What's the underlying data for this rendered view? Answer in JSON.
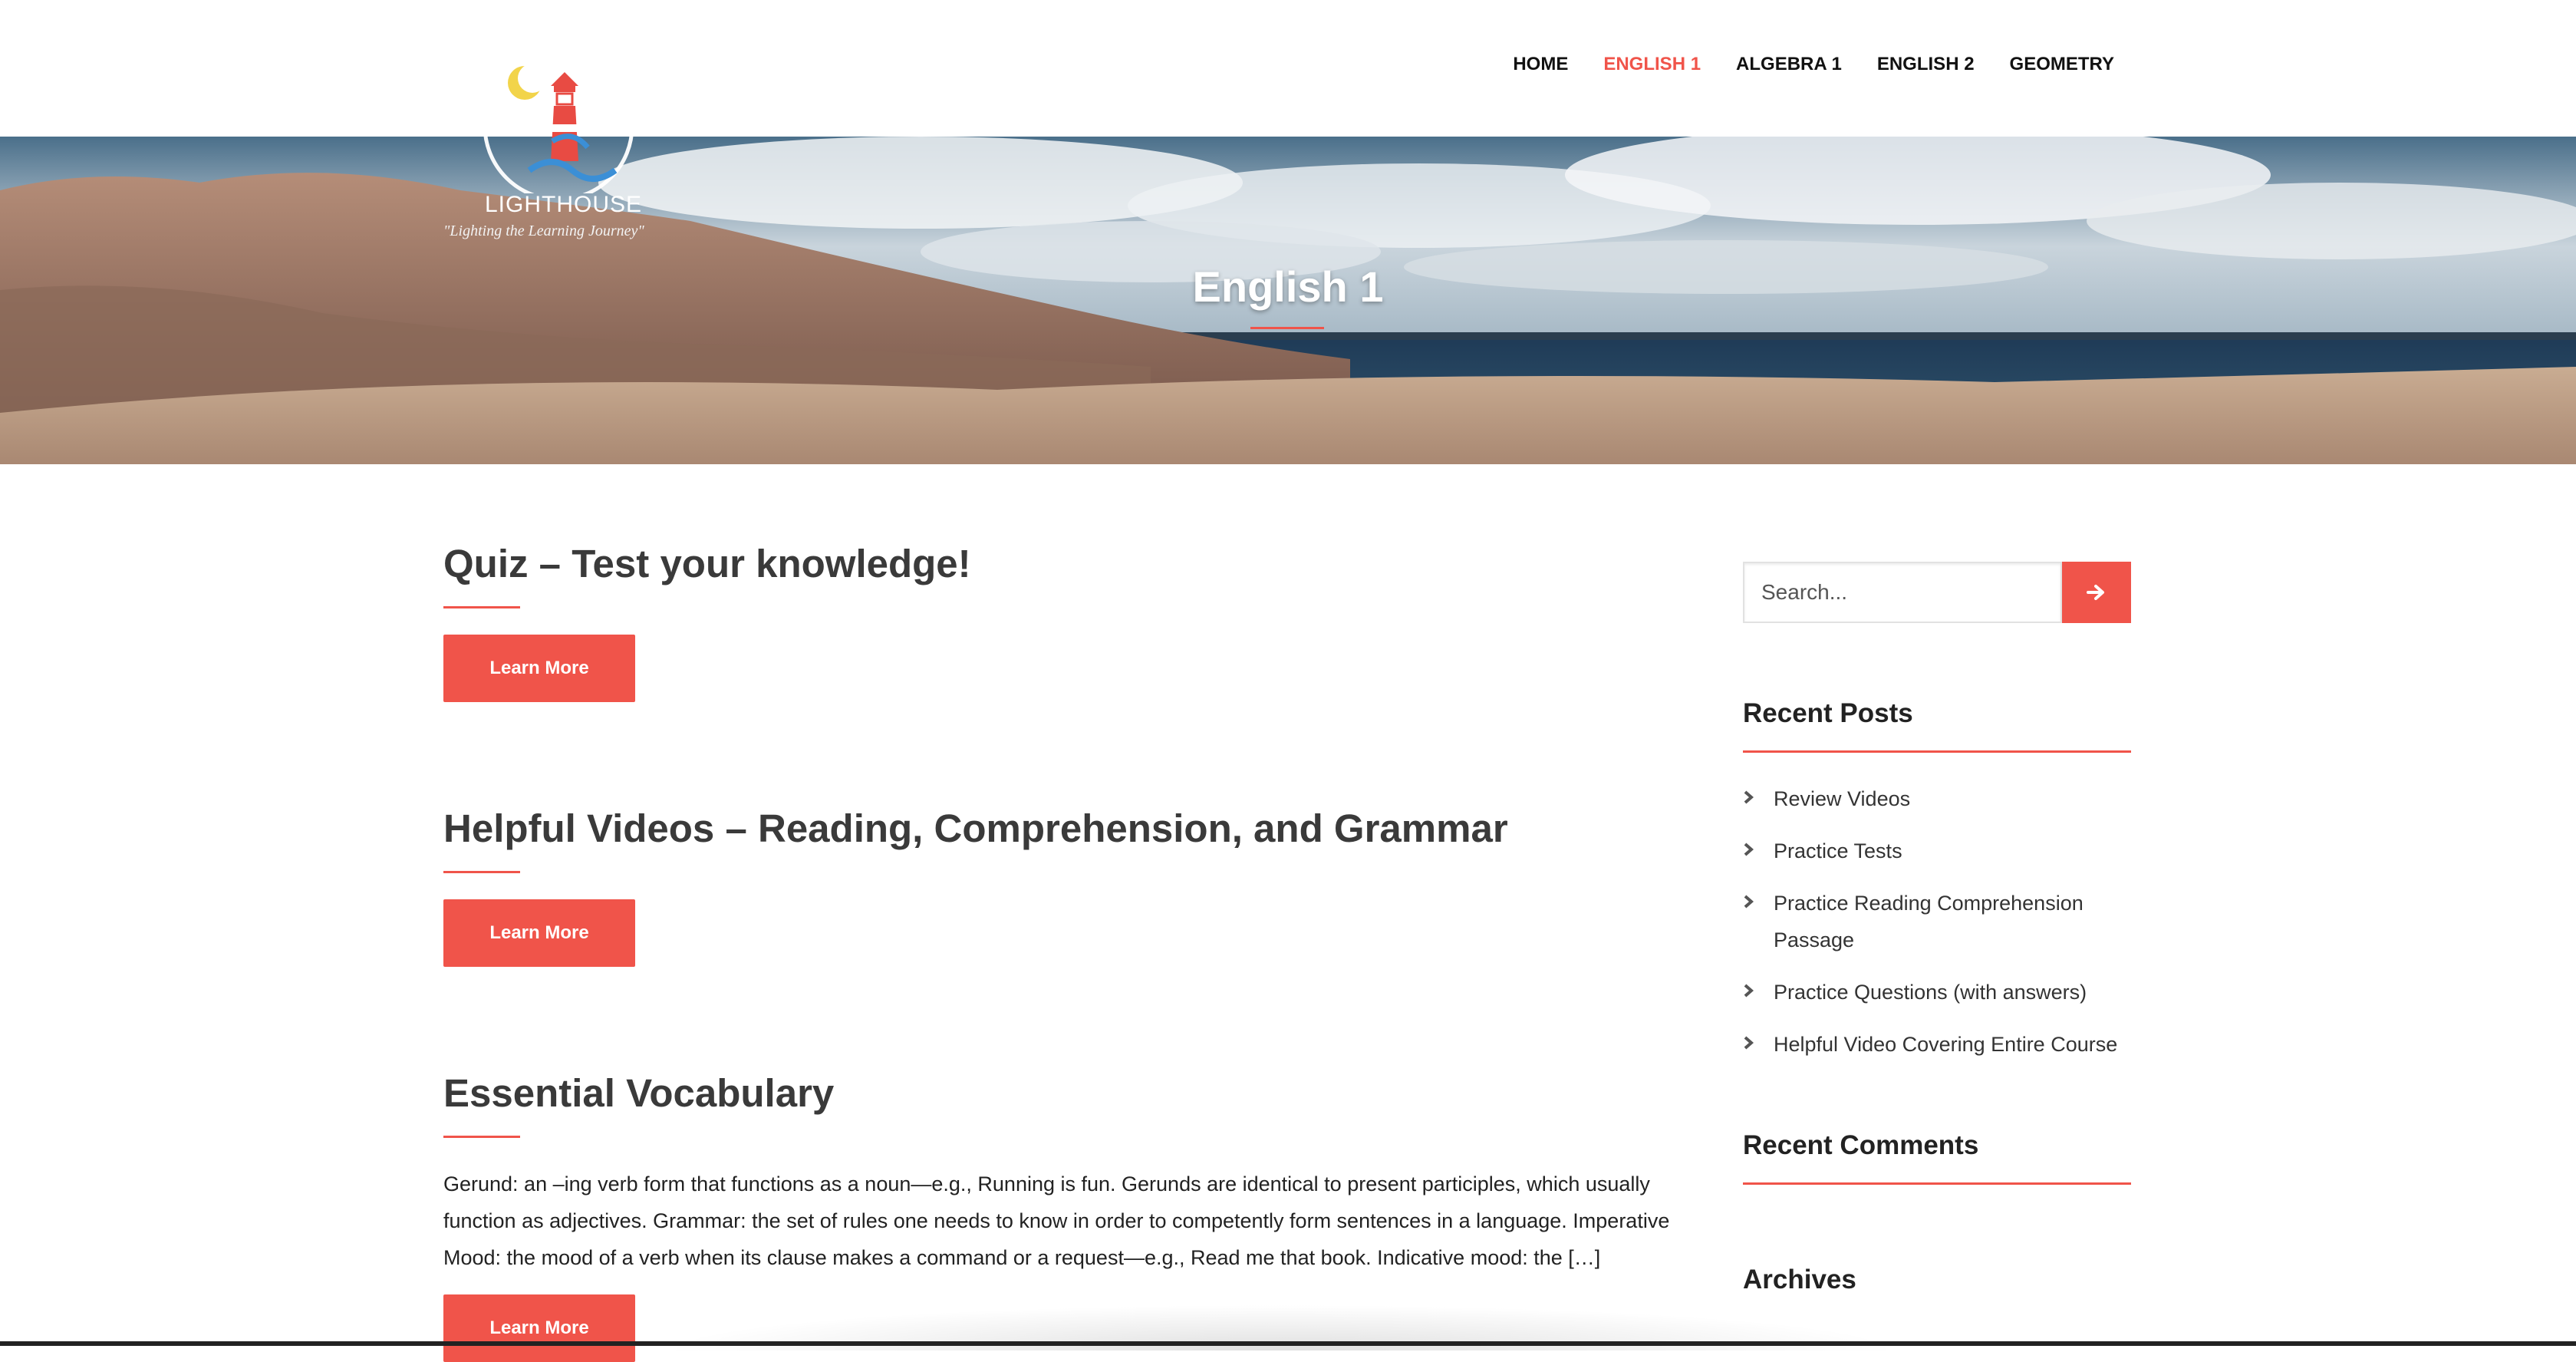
{
  "header": {
    "logo_name": "LIGHTHOUSE",
    "logo_tagline": "\"Lighting the Learning Journey\"",
    "nav": [
      {
        "label": "HOME",
        "active": false
      },
      {
        "label": "ENGLISH 1",
        "active": true
      },
      {
        "label": "ALGEBRA 1",
        "active": false
      },
      {
        "label": "ENGLISH 2",
        "active": false
      },
      {
        "label": "GEOMETRY",
        "active": false
      }
    ]
  },
  "hero": {
    "title": "English 1"
  },
  "posts": [
    {
      "title": "Quiz – Test your knowledge!",
      "button": "Learn More"
    },
    {
      "title": "Helpful Videos – Reading, Comprehension, and Grammar",
      "button": "Learn More"
    },
    {
      "title": "Essential Vocabulary",
      "excerpt": "Gerund: an –ing verb form that functions as a noun—e.g., Running is fun. Gerunds are identical to present participles, which usually function as adjectives. Grammar: the set of rules one needs to know in order to competently form sentences in a language. Imperative Mood: the mood of a verb when its clause makes a command or a request—e.g., Read me that book. Indicative mood: the […]",
      "button": "Learn More"
    }
  ],
  "sidebar": {
    "search_placeholder": "Search...",
    "recent_posts_title": "Recent Posts",
    "recent_posts": [
      "Review Videos",
      "Practice Tests",
      "Practice Reading Comprehension Passage",
      "Practice Questions (with answers)",
      "Helpful Video Covering Entire Course"
    ],
    "recent_comments_title": "Recent Comments",
    "archives_title": "Archives"
  },
  "colors": {
    "accent": "#f0544a",
    "text": "#333333",
    "nav_text": "#111111"
  },
  "icons": {
    "search_submit": "arrow-right-icon",
    "list_bullet": "chevron-right-icon",
    "logo": "lighthouse-logo-icon"
  }
}
